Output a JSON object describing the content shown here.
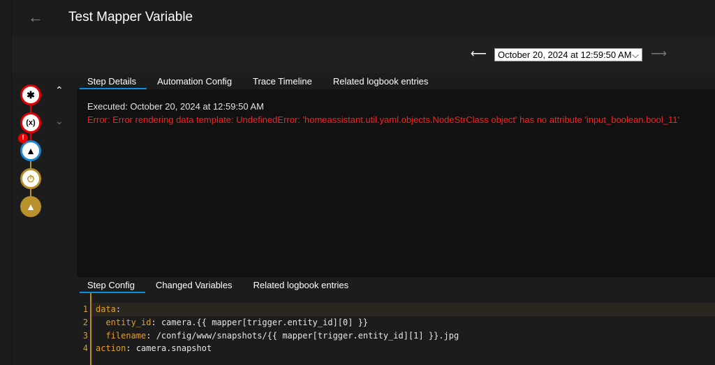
{
  "header": {
    "title": "Test Mapper Variable"
  },
  "toolbar": {
    "selected_run": "October 20, 2024 at 12:59:50 AM"
  },
  "top_tabs": [
    "Step Details",
    "Automation Config",
    "Trace Timeline",
    "Related logbook entries"
  ],
  "details": {
    "executed": "Executed: October 20, 2024 at 12:59:50 AM",
    "error": "Error: Error rendering data template: UndefinedError: 'homeassistant.util.yaml.objects.NodeStrClass object' has no attribute 'input_boolean.bool_11'"
  },
  "bottom_tabs": [
    "Step Config",
    "Changed Variables",
    "Related logbook entries"
  ],
  "graph": {
    "badge": "!",
    "nodes": [
      {
        "icon": "asterisk",
        "color": "#e00000"
      },
      {
        "icon": "variable",
        "color": "#e00000"
      },
      {
        "icon": "service-bell",
        "color": "#1e88d0"
      },
      {
        "icon": "timer",
        "color": "#b8902c"
      },
      {
        "icon": "service-bell",
        "color": "#b8902c"
      }
    ]
  },
  "code": {
    "lines": [
      {
        "n": "1",
        "key": "data",
        "rest": ""
      },
      {
        "n": "2",
        "key": "  entity_id",
        "rest": " camera.{{ mapper[trigger.entity_id][0] }}"
      },
      {
        "n": "3",
        "key": "  filename",
        "rest": " /config/www/snapshots/{{ mapper[trigger.entity_id][1] }}.jpg"
      },
      {
        "n": "4",
        "key": "action",
        "rest": " camera.snapshot"
      }
    ]
  }
}
